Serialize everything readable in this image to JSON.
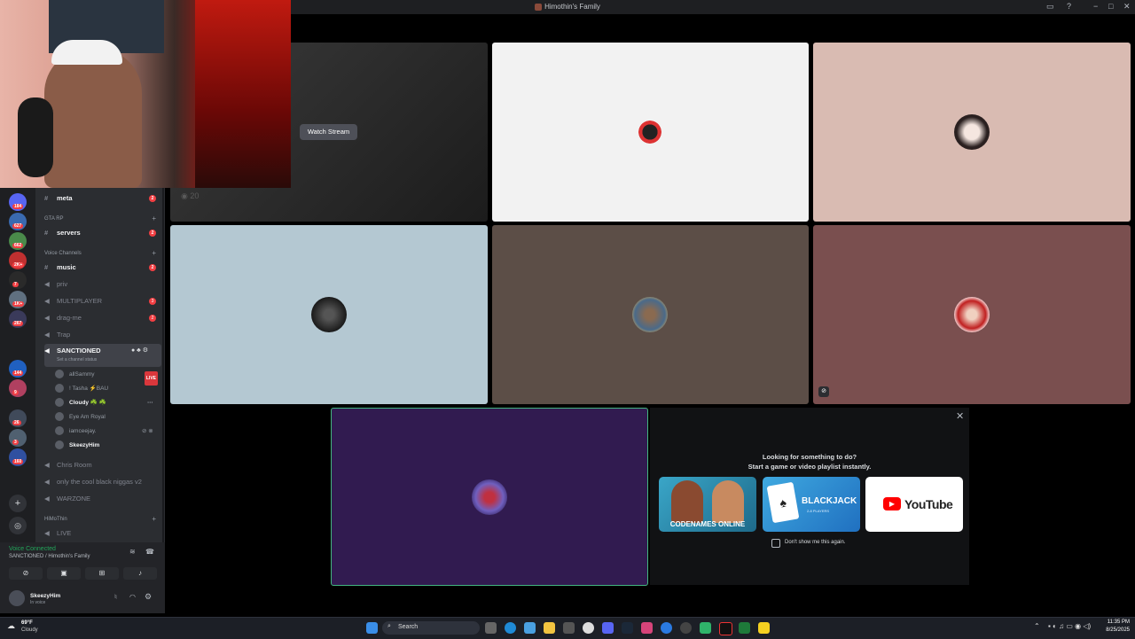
{
  "window": {
    "title": "Himothin's Family",
    "controls": [
      "−",
      "□",
      "✕"
    ]
  },
  "stream": {
    "watch_label": "Watch Stream",
    "viewer_count": "20"
  },
  "server_badges": [
    "184",
    "627",
    "662",
    "2K+",
    "7",
    "1K+",
    "267",
    "144",
    "9",
    "26",
    "3",
    "160"
  ],
  "channels": {
    "top": [
      {
        "name": "meta",
        "count": "2"
      }
    ],
    "cat_gta": "GTA RP",
    "servers": {
      "name": "servers",
      "count": "2"
    },
    "cat_voice": "Voice Channels",
    "music": {
      "name": "music",
      "count": "2"
    },
    "voice": [
      {
        "name": "priv",
        "count": ""
      },
      {
        "name": "MULTIPLAYER",
        "count": "3"
      },
      {
        "name": "drag-me",
        "count": "2"
      },
      {
        "name": "Trap",
        "count": ""
      }
    ],
    "current": {
      "name": "SANCTIONED",
      "status": "Set a channel status"
    },
    "users": [
      {
        "name": "allSammy",
        "live": "LIVE"
      },
      {
        "name": "! Tasha ⚡BAU",
        "live": ""
      },
      {
        "name": "Cloudy ☘️ ☘️",
        "live": ""
      },
      {
        "name": "Eye Am Royal",
        "live": ""
      },
      {
        "name": "iamceejay.",
        "live": ""
      },
      {
        "name": "SkeezyHim",
        "live": ""
      }
    ],
    "more_voice": [
      "Chris Room",
      "only the cool black niggas v2",
      "WARZONE"
    ],
    "cat_himo": "HiMoThin",
    "live_channel": "LIVE"
  },
  "voice_panel": {
    "connected": "Voice Connected",
    "location": "SANCTIONED / Himothin's Family"
  },
  "user": {
    "name": "SkeezyHim",
    "status": "In voice"
  },
  "activity": {
    "line1": "Looking for something to do?",
    "line2": "Start a game or video playlist instantly.",
    "games": [
      "CODENAMES ONLINE",
      "BLACKJACK",
      "YouTube"
    ],
    "dont_show": "Don't show me this again.",
    "blackjack_players": "2-8 PLAYERS"
  },
  "taskbar": {
    "weather_temp": "69°F",
    "weather_desc": "Cloudy",
    "search": "Search",
    "time": "11:35 PM",
    "date": "8/25/2025"
  },
  "colors": {
    "accent_green": "#23a55a",
    "mention_red": "#f23f43",
    "focus_tile": "#311b50",
    "focus_border": "#43b581"
  }
}
